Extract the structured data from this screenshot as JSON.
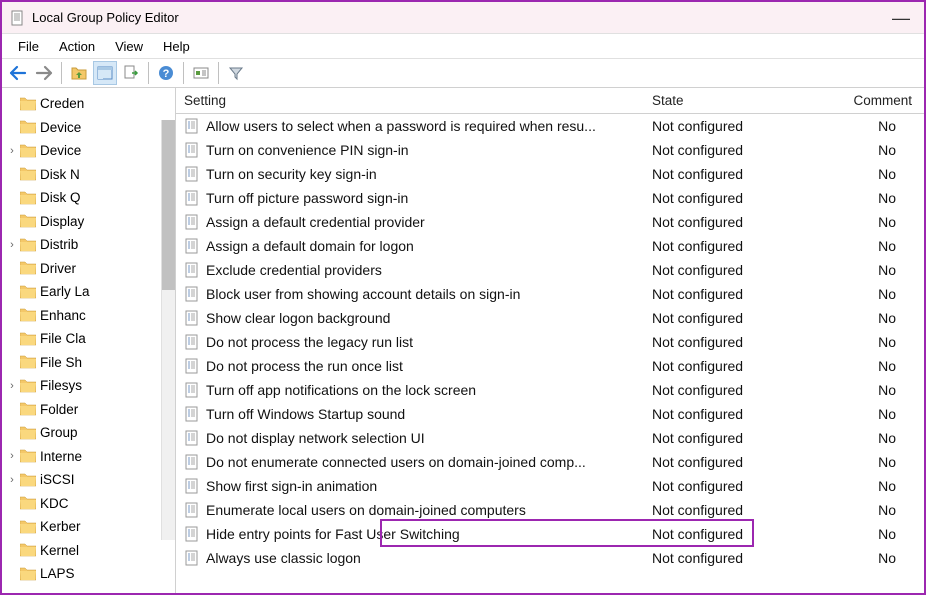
{
  "window": {
    "title": "Local Group Policy Editor"
  },
  "menu": {
    "file": "File",
    "action": "Action",
    "view": "View",
    "help": "Help"
  },
  "columns": {
    "setting": "Setting",
    "state": "State",
    "comment": "Comment"
  },
  "tree": [
    {
      "label": "Creden"
    },
    {
      "label": "Device"
    },
    {
      "label": "Device",
      "expandable": true
    },
    {
      "label": "Disk N"
    },
    {
      "label": "Disk Q"
    },
    {
      "label": "Display"
    },
    {
      "label": "Distrib",
      "expandable": true
    },
    {
      "label": "Driver"
    },
    {
      "label": "Early La"
    },
    {
      "label": "Enhanc"
    },
    {
      "label": "File Cla"
    },
    {
      "label": "File Sh"
    },
    {
      "label": "Filesys",
      "expandable": true
    },
    {
      "label": "Folder"
    },
    {
      "label": "Group"
    },
    {
      "label": "Interne",
      "expandable": true
    },
    {
      "label": "iSCSI",
      "expandable": true
    },
    {
      "label": "KDC"
    },
    {
      "label": "Kerber"
    },
    {
      "label": "Kernel"
    },
    {
      "label": "LAPS"
    }
  ],
  "policies": [
    {
      "name": "Allow users to select when a password is required when resu...",
      "state": "Not configured",
      "comment": "No"
    },
    {
      "name": "Turn on convenience PIN sign-in",
      "state": "Not configured",
      "comment": "No"
    },
    {
      "name": "Turn on security key sign-in",
      "state": "Not configured",
      "comment": "No"
    },
    {
      "name": "Turn off picture password sign-in",
      "state": "Not configured",
      "comment": "No"
    },
    {
      "name": "Assign a default credential provider",
      "state": "Not configured",
      "comment": "No"
    },
    {
      "name": "Assign a default domain for logon",
      "state": "Not configured",
      "comment": "No"
    },
    {
      "name": "Exclude credential providers",
      "state": "Not configured",
      "comment": "No"
    },
    {
      "name": "Block user from showing account details on sign-in",
      "state": "Not configured",
      "comment": "No"
    },
    {
      "name": "Show clear logon background",
      "state": "Not configured",
      "comment": "No"
    },
    {
      "name": "Do not process the legacy run list",
      "state": "Not configured",
      "comment": "No"
    },
    {
      "name": "Do not process the run once list",
      "state": "Not configured",
      "comment": "No"
    },
    {
      "name": "Turn off app notifications on the lock screen",
      "state": "Not configured",
      "comment": "No"
    },
    {
      "name": "Turn off Windows Startup sound",
      "state": "Not configured",
      "comment": "No"
    },
    {
      "name": "Do not display network selection UI",
      "state": "Not configured",
      "comment": "No"
    },
    {
      "name": "Do not enumerate connected users on domain-joined comp...",
      "state": "Not configured",
      "comment": "No"
    },
    {
      "name": "Show first sign-in animation",
      "state": "Not configured",
      "comment": "No"
    },
    {
      "name": "Enumerate local users on domain-joined computers",
      "state": "Not configured",
      "comment": "No"
    },
    {
      "name": "Hide entry points for Fast User Switching",
      "state": "Not configured",
      "comment": "No",
      "highlighted": true
    },
    {
      "name": "Always use classic logon",
      "state": "Not configured",
      "comment": "No"
    }
  ]
}
